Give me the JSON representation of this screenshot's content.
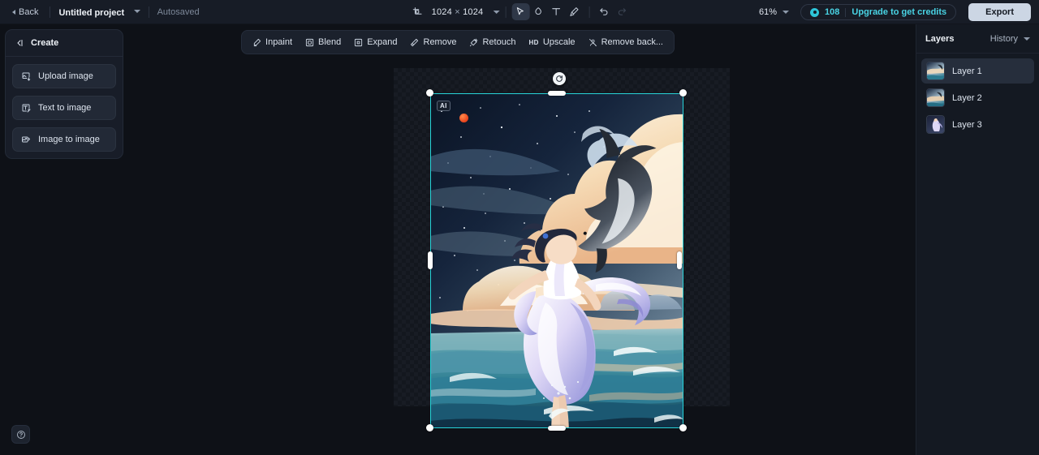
{
  "topbar": {
    "back_label": "Back",
    "project_name": "Untitled project",
    "autosaved_label": "Autosaved",
    "canvas_width": "1024",
    "dim_separator": "×",
    "canvas_height": "1024",
    "tools": [
      {
        "name": "crop-resize-icon",
        "label": "Resize canvas"
      },
      {
        "name": "select-tool",
        "label": "Select"
      },
      {
        "name": "eraser-tool",
        "label": "Eraser"
      },
      {
        "name": "text-tool",
        "label": "Text"
      },
      {
        "name": "brush-tool",
        "label": "Brush"
      },
      {
        "name": "undo-button",
        "label": "Undo"
      },
      {
        "name": "redo-button",
        "label": "Redo"
      }
    ],
    "zoom_level": "61%",
    "credits_count": "108",
    "upgrade_label": "Upgrade to get credits",
    "export_label": "Export",
    "accent_color": "#49d3e4",
    "export_bg": "#ccd6e4"
  },
  "create_panel": {
    "title": "Create",
    "items": [
      {
        "label": "Upload image",
        "icon": "upload-image-icon"
      },
      {
        "label": "Text to image",
        "icon": "text-to-image-icon"
      },
      {
        "label": "Image to image",
        "icon": "image-to-image-icon"
      }
    ]
  },
  "float_toolbar": {
    "items": [
      {
        "label": "Inpaint",
        "icon": "inpaint-icon"
      },
      {
        "label": "Blend",
        "icon": "blend-icon"
      },
      {
        "label": "Expand",
        "icon": "expand-icon"
      },
      {
        "label": "Remove",
        "icon": "remove-icon"
      },
      {
        "label": "Retouch",
        "icon": "retouch-icon"
      },
      {
        "label": "Upscale",
        "icon": "upscale-icon",
        "badge": "HD"
      },
      {
        "label": "Remove back...",
        "icon": "remove-background-icon"
      }
    ]
  },
  "canvas": {
    "ai_badge": "AI",
    "selection_color": "#27d3d8",
    "artwork_alt": "Anime illustration of a girl in a flowing dress standing in ocean waves beneath a starry sky with clouds and a leaping dolphin"
  },
  "layers_panel": {
    "title": "Layers",
    "history_label": "History",
    "layers": [
      {
        "label": "Layer 1",
        "selected": true
      },
      {
        "label": "Layer 2",
        "selected": false
      },
      {
        "label": "Layer 3",
        "selected": false
      }
    ]
  },
  "help": {
    "label": "Help"
  }
}
